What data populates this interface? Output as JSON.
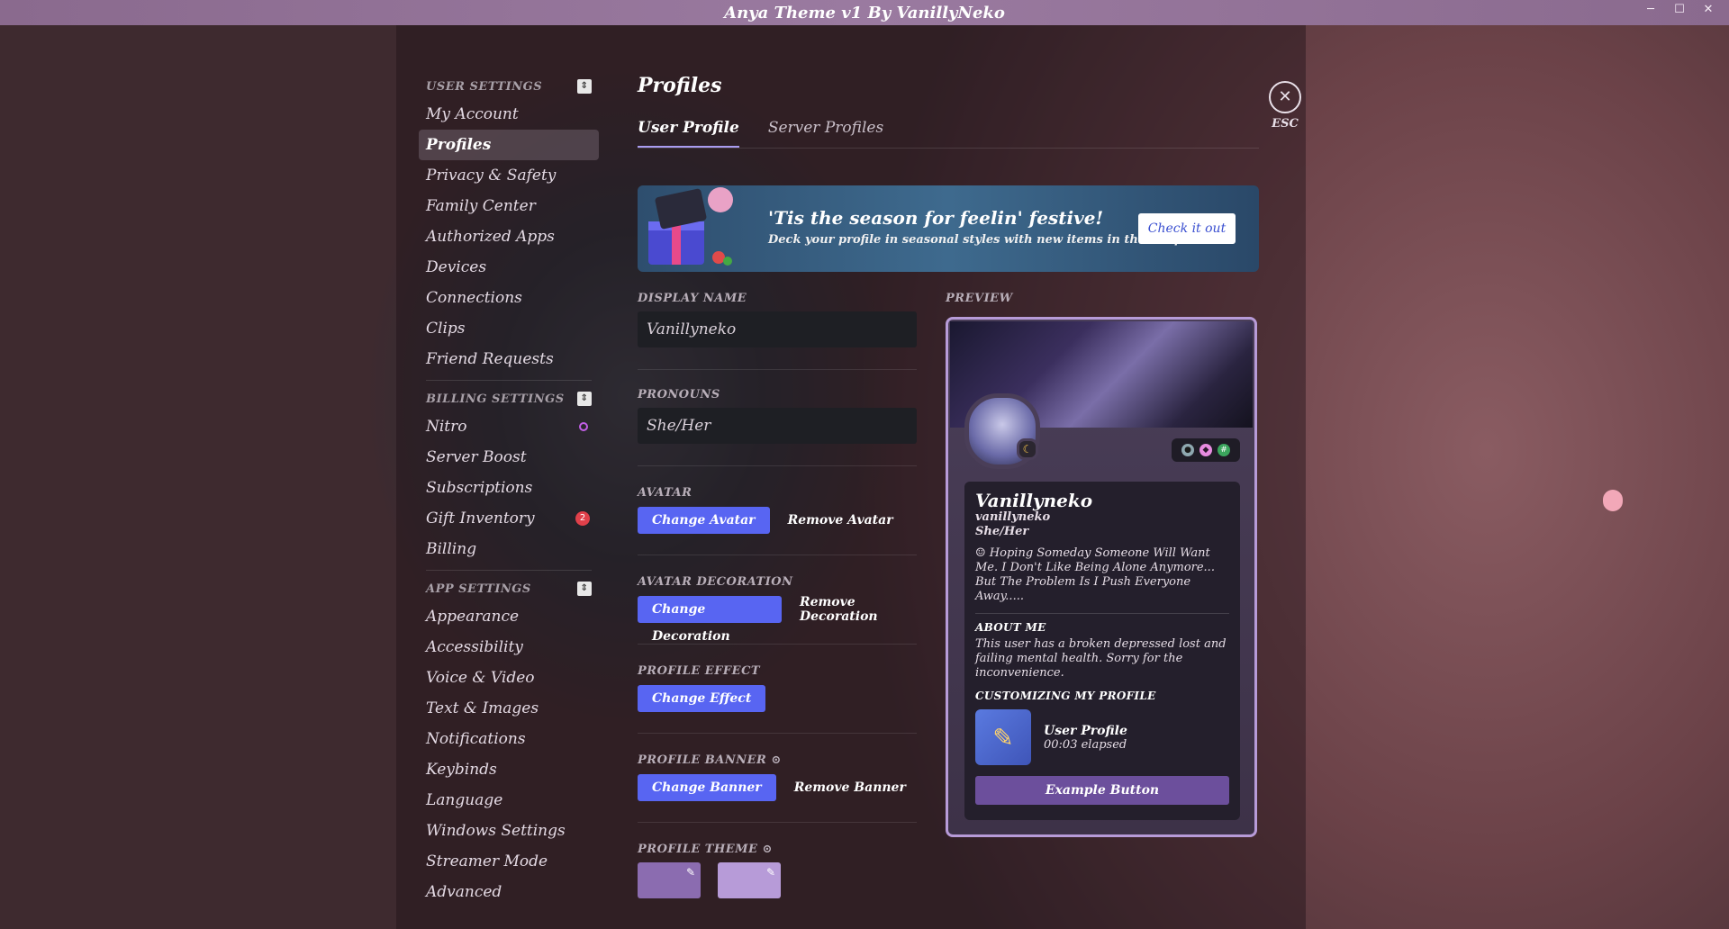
{
  "window": {
    "title": "Anya Theme v1 By VanillyNeko",
    "controls": [
      "─",
      "☐",
      "✕"
    ]
  },
  "sidebar": {
    "sections": [
      {
        "title": "USER SETTINGS",
        "items": [
          "My Account",
          "Profiles",
          "Privacy & Safety",
          "Family Center",
          "Authorized Apps",
          "Devices",
          "Connections",
          "Clips",
          "Friend Requests"
        ]
      },
      {
        "title": "BILLING SETTINGS",
        "items": [
          "Nitro",
          "Server Boost",
          "Subscriptions",
          "Gift Inventory",
          "Billing"
        ]
      },
      {
        "title": "APP SETTINGS",
        "items": [
          "Appearance",
          "Accessibility",
          "Voice & Video",
          "Text & Images",
          "Notifications",
          "Keybinds",
          "Language",
          "Windows Settings",
          "Streamer Mode",
          "Advanced"
        ]
      }
    ],
    "active_item": "Profiles",
    "gift_badge": "2"
  },
  "main": {
    "title": "Profiles",
    "tabs": [
      "User Profile",
      "Server Profiles"
    ],
    "active_tab": "User Profile",
    "promo": {
      "headline": "'Tis the season for feelin' festive!",
      "subtext": "Deck your profile in seasonal styles with new items in the Shop.",
      "button": "Check it out"
    },
    "display_name": {
      "label": "DISPLAY NAME",
      "value": "Vanillyneko"
    },
    "pronouns": {
      "label": "PRONOUNS",
      "value": "She/Her"
    },
    "avatar": {
      "label": "AVATAR",
      "primary": "Change Avatar",
      "secondary": "Remove Avatar"
    },
    "decoration": {
      "label": "AVATAR DECORATION",
      "primary": "Change Decoration",
      "secondary": "Remove Decoration"
    },
    "effect": {
      "label": "PROFILE EFFECT",
      "primary": "Change Effect"
    },
    "banner": {
      "label": "PROFILE BANNER",
      "primary": "Change Banner",
      "secondary": "Remove Banner"
    },
    "theme": {
      "label": "PROFILE THEME",
      "swatches": [
        "#8b6cb0",
        "#b79bd8"
      ]
    }
  },
  "preview": {
    "label": "PREVIEW",
    "name": "Vanillyneko",
    "username": "vanillyneko",
    "pronouns": "She/Her",
    "bio": "Hoping Someday Someone Will Want Me. I Don't Like Being Alone Anymore... But The Problem Is I Push Everyone Away.....",
    "about_title": "ABOUT ME",
    "about": "This user has a broken depressed lost and failing mental health. Sorry for the inconvenience.",
    "custom_title": "CUSTOMIZING MY PROFILE",
    "activity_title": "User Profile",
    "activity_time": "00:03 elapsed",
    "example_button": "Example Button"
  },
  "close": {
    "icon": "close-icon",
    "label": "ESC"
  }
}
